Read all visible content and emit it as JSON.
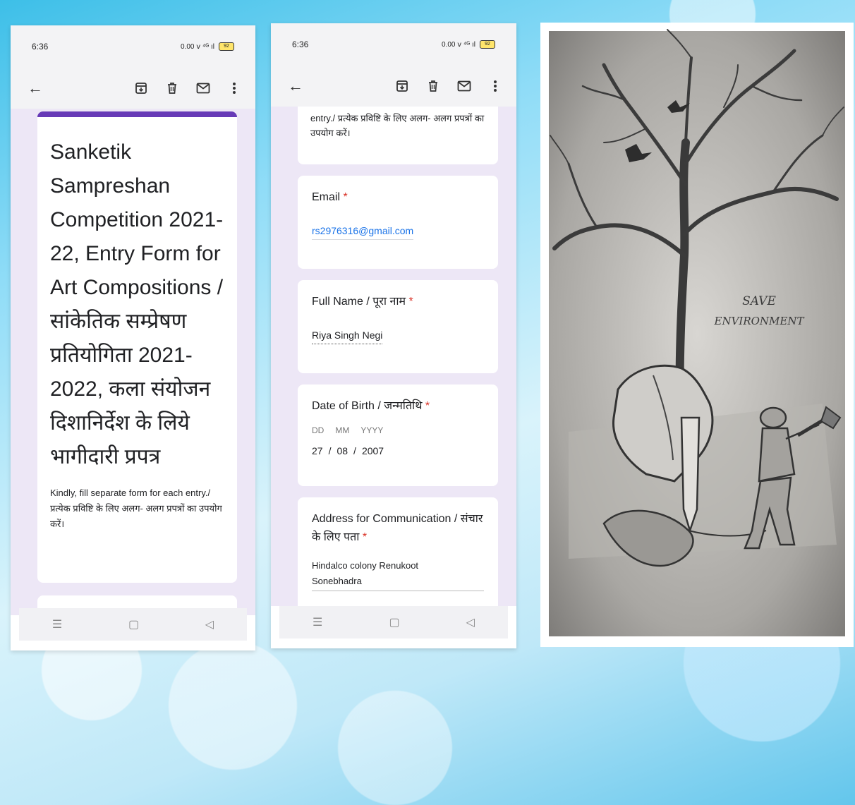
{
  "phone1": {
    "status_time": "6:36",
    "status_icons": "0.00 ⅴ ⁴ᴳ ıl",
    "battery": "92",
    "form_title": "Sanketik Sampreshan Competition 2021-22, Entry Form for Art Compositions / सांकेतिक सम्प्रेषण प्रतियोगिता 2021-2022, कला संयोजन दिशानिर्देश के लिये भागीदारी प्रपत्र",
    "form_description": "Kindly, fill separate form for each entry./ प्रत्येक प्रविष्टि के लिए अलग- अलग प्रपत्रों का उपयोग करें।"
  },
  "phone2": {
    "status_time": "6:36",
    "status_icons": "0.00 ⅴ ⁴ᴳ ıl",
    "battery": "92",
    "desc_tail": "entry./ प्रत्येक प्रविष्टि के लिए अलग- अलग प्रपत्रों का उपयोग करें।",
    "email_label": "Email",
    "email_value": "rs2976316@gmail.com",
    "name_label": "Full Name / पूरा नाम",
    "name_value": "Riya Singh Negi",
    "dob_label": "Date of Birth / जन्मतिथि",
    "dob_dd": "DD",
    "dob_mm": "MM",
    "dob_yyyy": "YYYY",
    "dob_day": "27",
    "dob_month": "08",
    "dob_year": "2007",
    "dob_sep": "/",
    "address_label": "Address for Communication / संचार के लिए पता",
    "address_value_line1": "Hindalco colony Renukoot",
    "address_value_line2": "Sonebhadra",
    "required_mark": "*"
  },
  "drawing": {
    "caption_line1": "SAVE",
    "caption_line2": "ENVIRONMENT"
  },
  "icons": {
    "back": "arrow-left-icon",
    "archive": "archive-icon",
    "delete": "trash-icon",
    "mail": "mail-icon",
    "more": "more-vert-icon",
    "nav_menu": "menu-icon",
    "nav_home": "home-icon",
    "nav_back": "triangle-back-icon"
  },
  "colors": {
    "accent": "#673ab7",
    "form_bg": "#ede7f6",
    "required": "#d93025",
    "link": "#1a73e8"
  }
}
